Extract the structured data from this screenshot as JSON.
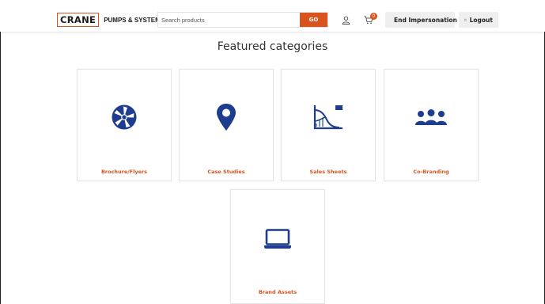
{
  "header": {
    "logo_word": "CRANE",
    "logo_tagline": "PUMPS & SYSTEMS",
    "search_placeholder": "Search products",
    "go_label": "GO",
    "cart_count": "0",
    "end_impersonation_label": "End Impersonation",
    "logout_label": "Logout"
  },
  "main": {
    "title": "Featured categories",
    "categories": [
      {
        "label": "Brochure/Flyers",
        "icon": "fan-icon"
      },
      {
        "label": "Case Studies",
        "icon": "map-pin-icon"
      },
      {
        "label": "Sales Sheets",
        "icon": "pump-curve-chart-icon"
      },
      {
        "label": "Co-Branding",
        "icon": "users-group-icon"
      },
      {
        "label": "Brand Assets",
        "icon": "laptop-icon"
      }
    ]
  },
  "colors": {
    "accent": "#d9531e",
    "icon_blue": "#1f3d8f",
    "pill_bg": "#efefef"
  }
}
